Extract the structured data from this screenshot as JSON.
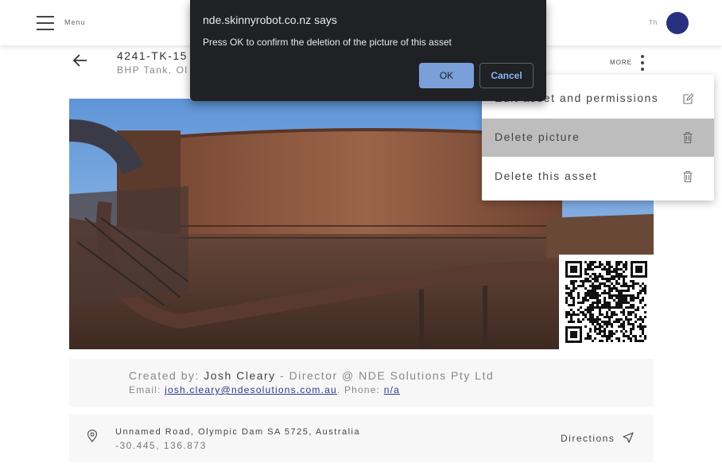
{
  "topbar": {
    "menu_label": "Menu",
    "user_initials": "Th"
  },
  "asset": {
    "id": "4241-TK-15",
    "subtitle": "BHP Tank, Ol"
  },
  "more": {
    "label": "MORE"
  },
  "dropdown": {
    "items": [
      {
        "label": "Edit asset and permissions",
        "icon": "edit-icon"
      },
      {
        "label": "Delete picture",
        "icon": "trash-icon"
      },
      {
        "label": "Delete this asset",
        "icon": "trash-icon"
      }
    ]
  },
  "dialog": {
    "title": "nde.skinnyrobot.co.nz says",
    "message": "Press OK to confirm the deletion of the picture of this asset",
    "ok_label": "OK",
    "cancel_label": "Cancel"
  },
  "creator": {
    "prefix": "Created by: ",
    "name": "Josh Cleary",
    "role": " - Director @ NDE Solutions Pty Ltd",
    "email_prefix": "Email: ",
    "email": "josh.cleary@ndesolutions.com.au",
    "phone_prefix": ". Phone: ",
    "phone": "n/a"
  },
  "location": {
    "address": "Unnamed Road, Olympic Dam SA 5725, Australia",
    "coords": "-30.445, 136.873",
    "directions_label": "Directions"
  },
  "colors": {
    "avatar": "#283180",
    "dialog_bg": "#202124",
    "ok_button": "#7a9fd9",
    "link": "#2d3a8c"
  }
}
